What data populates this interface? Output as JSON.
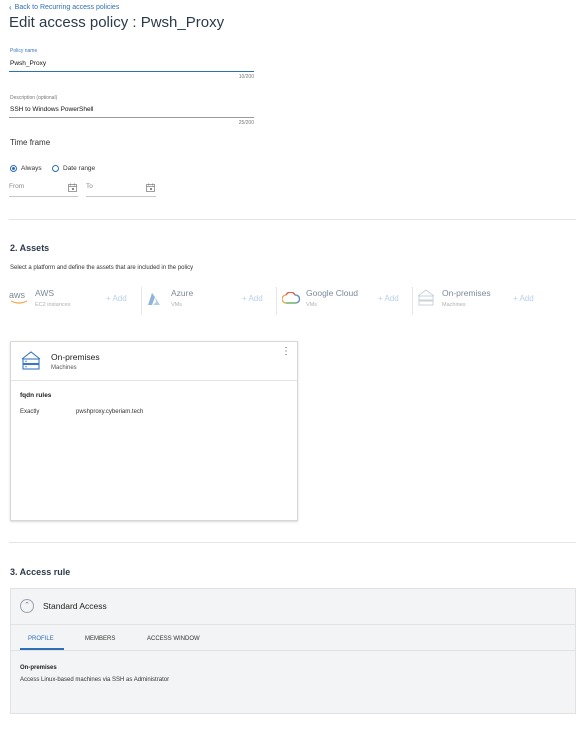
{
  "header": {
    "back_link": "Back to Recurring access policies",
    "title": "Edit access policy : Pwsh_Proxy"
  },
  "policy_name": {
    "label": "Policy name",
    "value": "Pwsh_Proxy",
    "counter": "10/200"
  },
  "description": {
    "label": "Description (optional)",
    "value": "SSH to Windows PowerShell",
    "counter": "25/200"
  },
  "time_frame": {
    "label": "Time frame",
    "options": [
      "Always",
      "Date range"
    ],
    "selected": "Always",
    "from_placeholder": "From",
    "to_placeholder": "To"
  },
  "assets": {
    "title": "2. Assets",
    "subtitle": "Select a platform and define the assets that are included in the policy",
    "platforms": [
      {
        "name": "AWS",
        "sub": "EC2 instances",
        "add": "+ Add",
        "icon": "aws-icon"
      },
      {
        "name": "Azure",
        "sub": "VMs",
        "add": "+ Add",
        "icon": "azure-icon"
      },
      {
        "name": "Google Cloud",
        "sub": "VMs",
        "add": "+ Add",
        "icon": "google-cloud-icon"
      },
      {
        "name": "On-premises",
        "sub": "Machines",
        "add": "+ Add",
        "icon": "server-icon"
      }
    ],
    "selected_card": {
      "title": "On-premises",
      "sub": "Machines",
      "rules_title": "fqdn rules",
      "rule_type": "Exactly",
      "rule_value": "pwshproxy.cyberiam.tech"
    }
  },
  "access_rule": {
    "title": "3. Access rule",
    "rule_name": "Standard Access",
    "tabs": [
      "PROFILE",
      "MEMBERS",
      "ACCESS WINDOW"
    ],
    "active_tab": "PROFILE",
    "profile_heading": "On-premises",
    "profile_text": "Access Linux-based machines via SSH as Administrator"
  },
  "colors": {
    "accent": "#2f6fb5",
    "title": "#2b3a4a",
    "divider": "#e4e4e4"
  }
}
